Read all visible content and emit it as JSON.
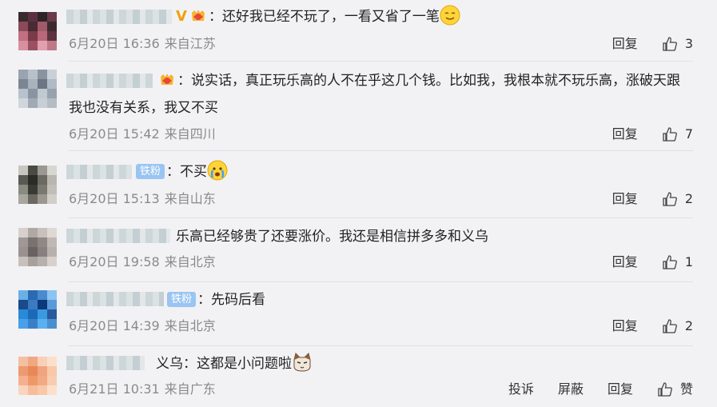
{
  "colors": {
    "background": "#f2f2f5",
    "meta": "#8a8a8a",
    "iron_badge": "#9ac4f2",
    "v_badge": "#f0a10a"
  },
  "comments": [
    {
      "badges": [
        "v-badge-icon",
        "fan-badge-icon"
      ],
      "text": "：还好我已经不玩了，一看又省了一笔",
      "emoji": "smile-emoji-icon",
      "date": "6月20日 16:36",
      "location": "来自江苏",
      "reply_label": "回复",
      "likes": "3"
    },
    {
      "badges": [
        "fan-badge-icon"
      ],
      "text": "：说实话，真正玩乐高的人不在乎这几个钱。比如我，我根本就不玩乐高，涨破天跟我也没有关系，我又不买",
      "date": "6月20日 15:42",
      "location": "来自四川",
      "reply_label": "回复",
      "likes": "7"
    },
    {
      "badge_text": "铁粉",
      "text": "：不买",
      "emoji": "crying-emoji-icon",
      "date": "6月20日 15:13",
      "location": "来自山东",
      "reply_label": "回复",
      "likes": "2"
    },
    {
      "text": "乐高已经够贵了还要涨价。我还是相信拼多多和义乌",
      "date": "6月20日 19:58",
      "location": "来自北京",
      "reply_label": "回复",
      "likes": "1"
    },
    {
      "badge_text": "铁粉",
      "text": "：先码后看",
      "date": "6月20日 14:39",
      "location": "来自北京",
      "reply_label": "回复",
      "likes": "2"
    },
    {
      "text": "义乌：这都是小问题啦",
      "emoji": "cat-emoji-icon",
      "date": "6月21日 10:31",
      "location": "来自广东",
      "report_label": "投诉",
      "block_label": "屏蔽",
      "reply_label": "回复",
      "like_label": "赞"
    }
  ]
}
